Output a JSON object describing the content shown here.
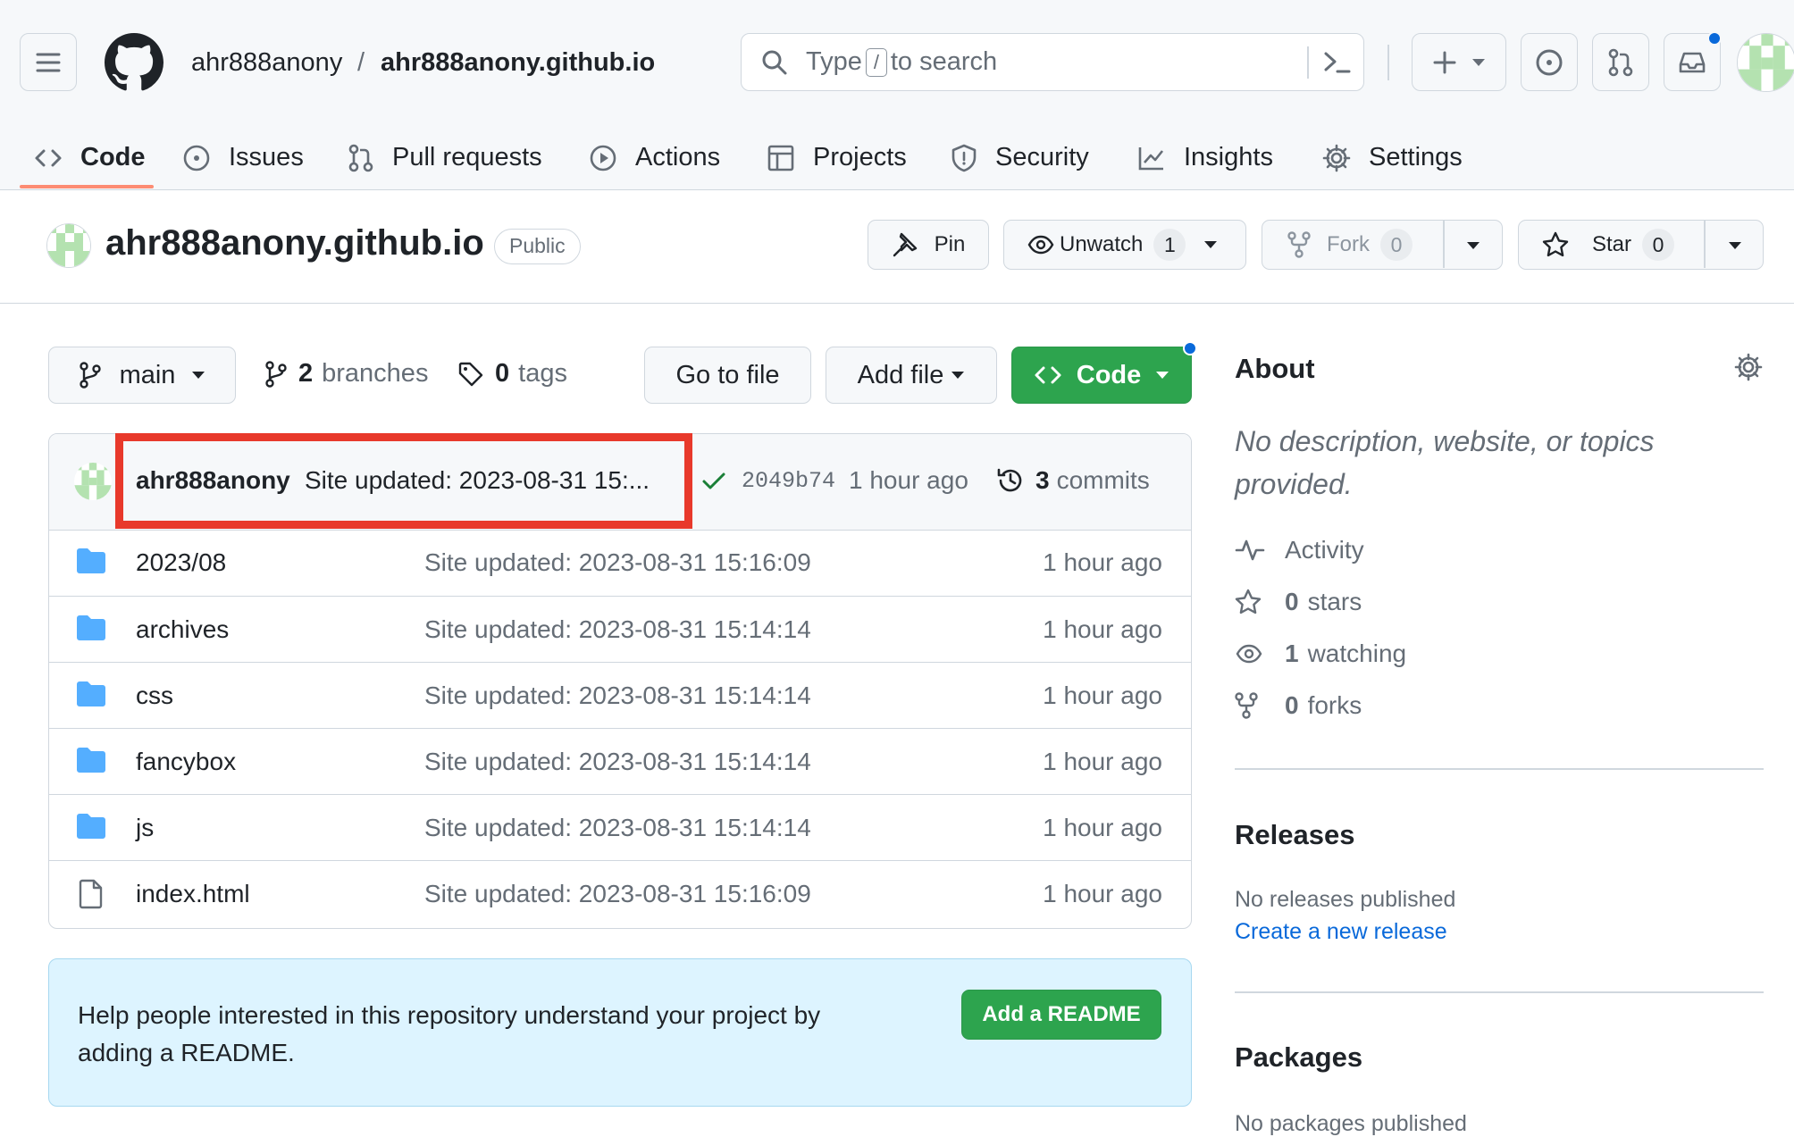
{
  "header": {
    "owner": "ahr888anony",
    "separator": "/",
    "repo": "ahr888anony.github.io",
    "search_prefix": "Type",
    "search_key": "/",
    "search_suffix": "to search"
  },
  "tabs": [
    {
      "label": "Code",
      "icon": "code-icon",
      "active": true
    },
    {
      "label": "Issues",
      "icon": "issue-icon"
    },
    {
      "label": "Pull requests",
      "icon": "pull-request-icon"
    },
    {
      "label": "Actions",
      "icon": "play-icon"
    },
    {
      "label": "Projects",
      "icon": "table-icon"
    },
    {
      "label": "Security",
      "icon": "shield-icon"
    },
    {
      "label": "Insights",
      "icon": "graph-icon"
    },
    {
      "label": "Settings",
      "icon": "gear-icon"
    }
  ],
  "repo": {
    "title": "ahr888anony.github.io",
    "visibility": "Public",
    "pin": "Pin",
    "unwatch": "Unwatch",
    "watch_count": "1",
    "fork": "Fork",
    "fork_count": "0",
    "star": "Star",
    "star_count": "0"
  },
  "toolbar": {
    "branch": "main",
    "branches_count": "2",
    "branches_label": "branches",
    "tags_count": "0",
    "tags_label": "tags",
    "goto_file": "Go to file",
    "add_file": "Add file",
    "code": "Code"
  },
  "commit": {
    "author": "ahr888anony",
    "message": "Site updated: 2023-08-31 15:...",
    "sha": "2049b74",
    "age": "1 hour ago",
    "commits_count": "3",
    "commits_label": "commits"
  },
  "files": [
    {
      "type": "folder",
      "name": "2023/08",
      "message": "Site updated: 2023-08-31 15:16:09",
      "age": "1 hour ago"
    },
    {
      "type": "folder",
      "name": "archives",
      "message": "Site updated: 2023-08-31 15:14:14",
      "age": "1 hour ago"
    },
    {
      "type": "folder",
      "name": "css",
      "message": "Site updated: 2023-08-31 15:14:14",
      "age": "1 hour ago"
    },
    {
      "type": "folder",
      "name": "fancybox",
      "message": "Site updated: 2023-08-31 15:14:14",
      "age": "1 hour ago"
    },
    {
      "type": "folder",
      "name": "js",
      "message": "Site updated: 2023-08-31 15:14:14",
      "age": "1 hour ago"
    },
    {
      "type": "file",
      "name": "index.html",
      "message": "Site updated: 2023-08-31 15:16:09",
      "age": "1 hour ago"
    }
  ],
  "readme": {
    "text": "Help people interested in this repository understand your project by adding a README.",
    "button": "Add a README"
  },
  "about": {
    "heading": "About",
    "description": "No description, website, or topics provided.",
    "activity": "Activity",
    "stars_count": "0",
    "stars_label": "stars",
    "watching_count": "1",
    "watching_label": "watching",
    "forks_count": "0",
    "forks_label": "forks"
  },
  "releases": {
    "heading": "Releases",
    "empty": "No releases published",
    "create": "Create a new release"
  },
  "packages": {
    "heading": "Packages",
    "empty": "No packages published"
  },
  "colors": {
    "accent_green": "#2da44e",
    "link_blue": "#0969da",
    "highlight_red": "#e8392b",
    "folder_blue": "#54aeff"
  }
}
